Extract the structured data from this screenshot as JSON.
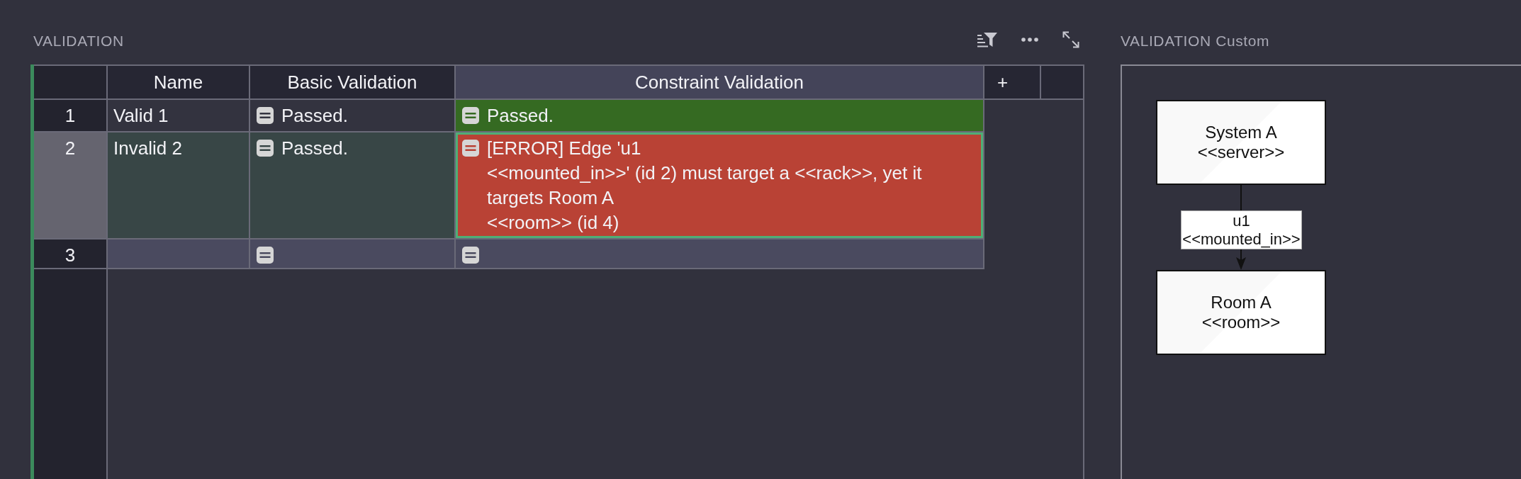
{
  "panel": {
    "title": "VALIDATION",
    "focused": true
  },
  "table": {
    "columns": [
      {
        "label": "Name",
        "kind": "text",
        "selected": false
      },
      {
        "label": "Basic Validation",
        "kind": "validation",
        "selected": false
      },
      {
        "label": "Constraint Validation",
        "kind": "validation",
        "selected": true
      }
    ],
    "add_column_label": "+",
    "rows": [
      {
        "number": "1",
        "selected": false,
        "hovered": false,
        "cells": [
          {
            "text": "Valid 1"
          },
          {
            "text": "Passed."
          },
          {
            "text": "Passed.",
            "color": "#356a22"
          }
        ]
      },
      {
        "number": "2",
        "selected": true,
        "hovered": false,
        "cells": [
          {
            "text": "Invalid 2"
          },
          {
            "text": "Passed."
          },
          {
            "text": "[ERROR] Edge 'u1\n<<mounted_in>>' (id 2) must target a <<rack>>, yet it targets Room A\n<<room>> (id 4)",
            "color": "#b94235"
          }
        ]
      },
      {
        "number": "3",
        "selected": false,
        "hovered": true,
        "cells": [
          {},
          {},
          {}
        ]
      }
    ]
  },
  "custom_panel": {
    "title": "VALIDATION Custom",
    "diagram": {
      "nodes": [
        {
          "name": "System A",
          "stereotype": "<<server>>"
        },
        {
          "name": "Room A",
          "stereotype": "<<room>>"
        }
      ],
      "edges": [
        {
          "name": "u1",
          "stereotype": "<<mounted_in>>"
        }
      ]
    }
  }
}
